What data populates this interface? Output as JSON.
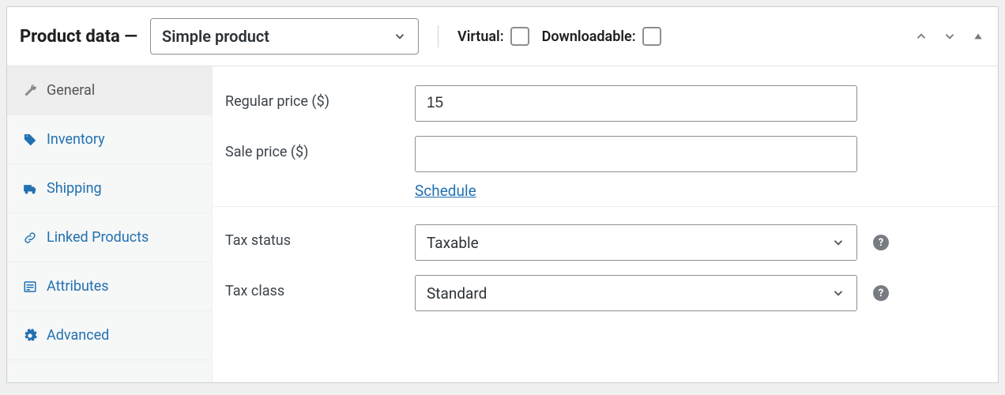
{
  "header": {
    "title": "Product data —",
    "product_type": "Simple product",
    "virtual_label": "Virtual:",
    "downloadable_label": "Downloadable:"
  },
  "sidebar": {
    "items": [
      {
        "label": "General"
      },
      {
        "label": "Inventory"
      },
      {
        "label": "Shipping"
      },
      {
        "label": "Linked Products"
      },
      {
        "label": "Attributes"
      },
      {
        "label": "Advanced"
      }
    ]
  },
  "general": {
    "regular_price_label": "Regular price ($)",
    "regular_price_value": "15",
    "sale_price_label": "Sale price ($)",
    "sale_price_value": "",
    "schedule_label": "Schedule",
    "tax_status_label": "Tax status",
    "tax_status_value": "Taxable",
    "tax_class_label": "Tax class",
    "tax_class_value": "Standard"
  }
}
